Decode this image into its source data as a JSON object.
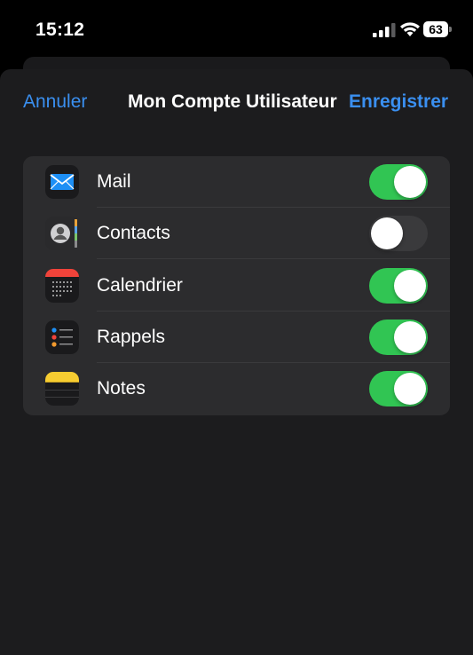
{
  "status_bar": {
    "time": "15:12",
    "battery": "63",
    "signal_icon": "cellular-signal-icon",
    "wifi_icon": "wifi-icon",
    "battery_icon": "battery-icon"
  },
  "nav": {
    "cancel_label": "Annuler",
    "title": "Mon Compte Utilisateur",
    "save_label": "Enregistrer"
  },
  "items": [
    {
      "label": "Mail",
      "icon": "mail-app-icon",
      "enabled": true
    },
    {
      "label": "Contacts",
      "icon": "contacts-app-icon",
      "enabled": false
    },
    {
      "label": "Calendrier",
      "icon": "calendar-app-icon",
      "enabled": true
    },
    {
      "label": "Rappels",
      "icon": "reminders-app-icon",
      "enabled": true
    },
    {
      "label": "Notes",
      "icon": "notes-app-icon",
      "enabled": true
    }
  ],
  "colors": {
    "accent": "#3a8ff0",
    "toggle_on": "#31c553",
    "toggle_off": "#3a3a3c",
    "background": "#000000",
    "sheet": "#1c1c1e",
    "card": "#2c2c2e"
  }
}
